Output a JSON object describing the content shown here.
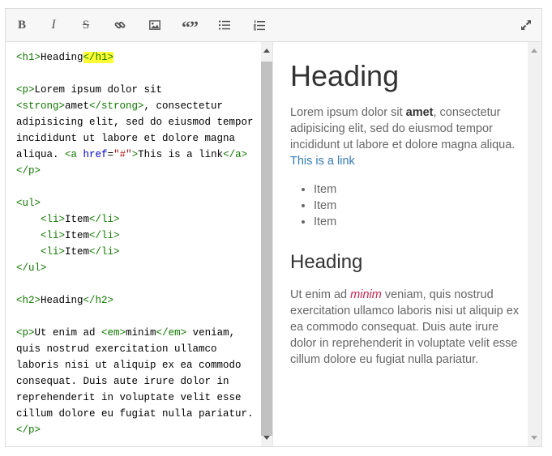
{
  "toolbar": {
    "bold_label": "B",
    "italic_label": "I",
    "strike_label": "S",
    "quote_label": "“”",
    "buttons": [
      "bold-icon",
      "italic-icon",
      "strikethrough-icon",
      "link-icon",
      "image-icon",
      "quote-icon",
      "unordered-list-icon",
      "ordered-list-icon",
      "fullscreen-icon"
    ]
  },
  "code": {
    "lines": [
      "<h1>Heading</h1>",
      "",
      "<p>Lorem ipsum dolor sit",
      "<strong>amet</strong>, consectetur",
      "adipisicing elit, sed do eiusmod tempor",
      "incididunt ut labore et dolore magna",
      "aliqua. <a href=\"#\">This is a link</a>",
      "</p>",
      "",
      "<ul>",
      "    <li>Item</li>",
      "    <li>Item</li>",
      "    <li>Item</li>",
      "</ul>",
      "",
      "<h2>Heading</h2>",
      "",
      "<p>Ut enim ad <em>minim</em> veniam,",
      "quis nostrud exercitation ullamco",
      "laboris nisi ut aliquip ex ea commodo",
      "consequat. Duis aute irure dolor in",
      "reprehenderit in voluptate velit esse",
      "cillum dolore eu fugiat nulla pariatur.",
      "</p>"
    ]
  },
  "preview": {
    "heading1": "Heading",
    "p1_text_before": "Lorem ipsum dolor sit ",
    "p1_strong": "amet",
    "p1_text_after": ", consectetur adipisicing elit, sed do eiusmod tempor incididunt ut labore et dolore magna aliqua. ",
    "p1_link": "This is a link",
    "list_items": [
      "Item",
      "Item",
      "Item"
    ],
    "heading2": "Heading",
    "p2_text_before": "Ut enim ad ",
    "p2_em": "minim",
    "p2_text_after": " veniam, quis nostrud exercitation ullamco laboris nisi ut aliquip ex ea commodo consequat. Duis aute irure dolor in reprehenderit in voluptate velit esse cillum dolore eu fugiat nulla pariatur."
  },
  "colors": {
    "tag": "#117700",
    "attribute": "#0000cc",
    "string": "#aa1111",
    "highlight": "#ffff33",
    "link": "#337ab7",
    "emphasis": "#c7254e"
  }
}
